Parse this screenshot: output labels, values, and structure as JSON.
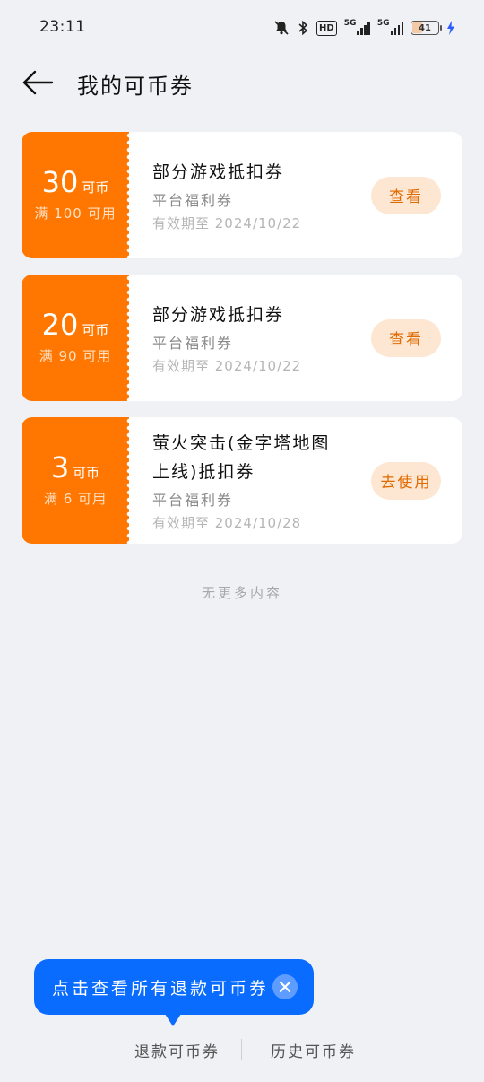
{
  "status_bar": {
    "time": "23:11",
    "network1_label": "5G",
    "network2_label": "5G",
    "hd_label": "HD",
    "battery_level": "41",
    "battery_percent": 41
  },
  "header": {
    "title": "我的可币券"
  },
  "coupons": [
    {
      "amount": "30",
      "unit": "可币",
      "condition": "满 100 可用",
      "name": "部分游戏抵扣券",
      "source": "平台福利券",
      "validity": "有效期至 2024/10/22",
      "action": "查看"
    },
    {
      "amount": "20",
      "unit": "可币",
      "condition": "满 90 可用",
      "name": "部分游戏抵扣券",
      "source": "平台福利券",
      "validity": "有效期至 2024/10/22",
      "action": "查看"
    },
    {
      "amount": "3",
      "unit": "可币",
      "condition": "满 6 可用",
      "name": "萤火突击(金字塔地图上线)抵扣券",
      "source": "平台福利券",
      "validity": "有效期至 2024/10/28",
      "action": "去使用"
    }
  ],
  "no_more": "无更多内容",
  "tooltip": {
    "text": "点击查看所有退款可币券"
  },
  "bottom_tabs": {
    "refund": "退款可币券",
    "history": "历史可币券"
  },
  "colors": {
    "accent": "#ff7700",
    "tooltip": "#0a6cff"
  }
}
